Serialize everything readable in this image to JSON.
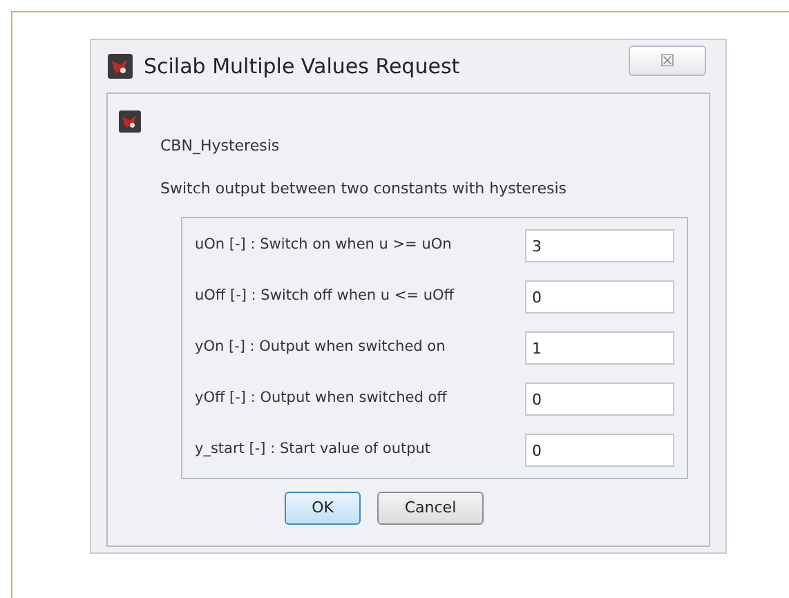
{
  "window": {
    "title": "Scilab Multiple Values Request",
    "close": "☒"
  },
  "block_name": "CBN_Hysteresis",
  "description": "Switch output between two constants with hysteresis",
  "fields": [
    {
      "label": "uOn [-] : Switch on when u >= uOn",
      "value": "3"
    },
    {
      "label": "uOff [-] : Switch off when u <= uOff",
      "value": "0"
    },
    {
      "label": "yOn [-] : Output when switched on",
      "value": "1"
    },
    {
      "label": "yOff [-] : Output when switched off",
      "value": "0"
    },
    {
      "label": "y_start [-] : Start value of output",
      "value": "0"
    }
  ],
  "buttons": [
    {
      "label": "OK",
      "default": true
    },
    {
      "label": "Cancel",
      "default": false
    }
  ]
}
